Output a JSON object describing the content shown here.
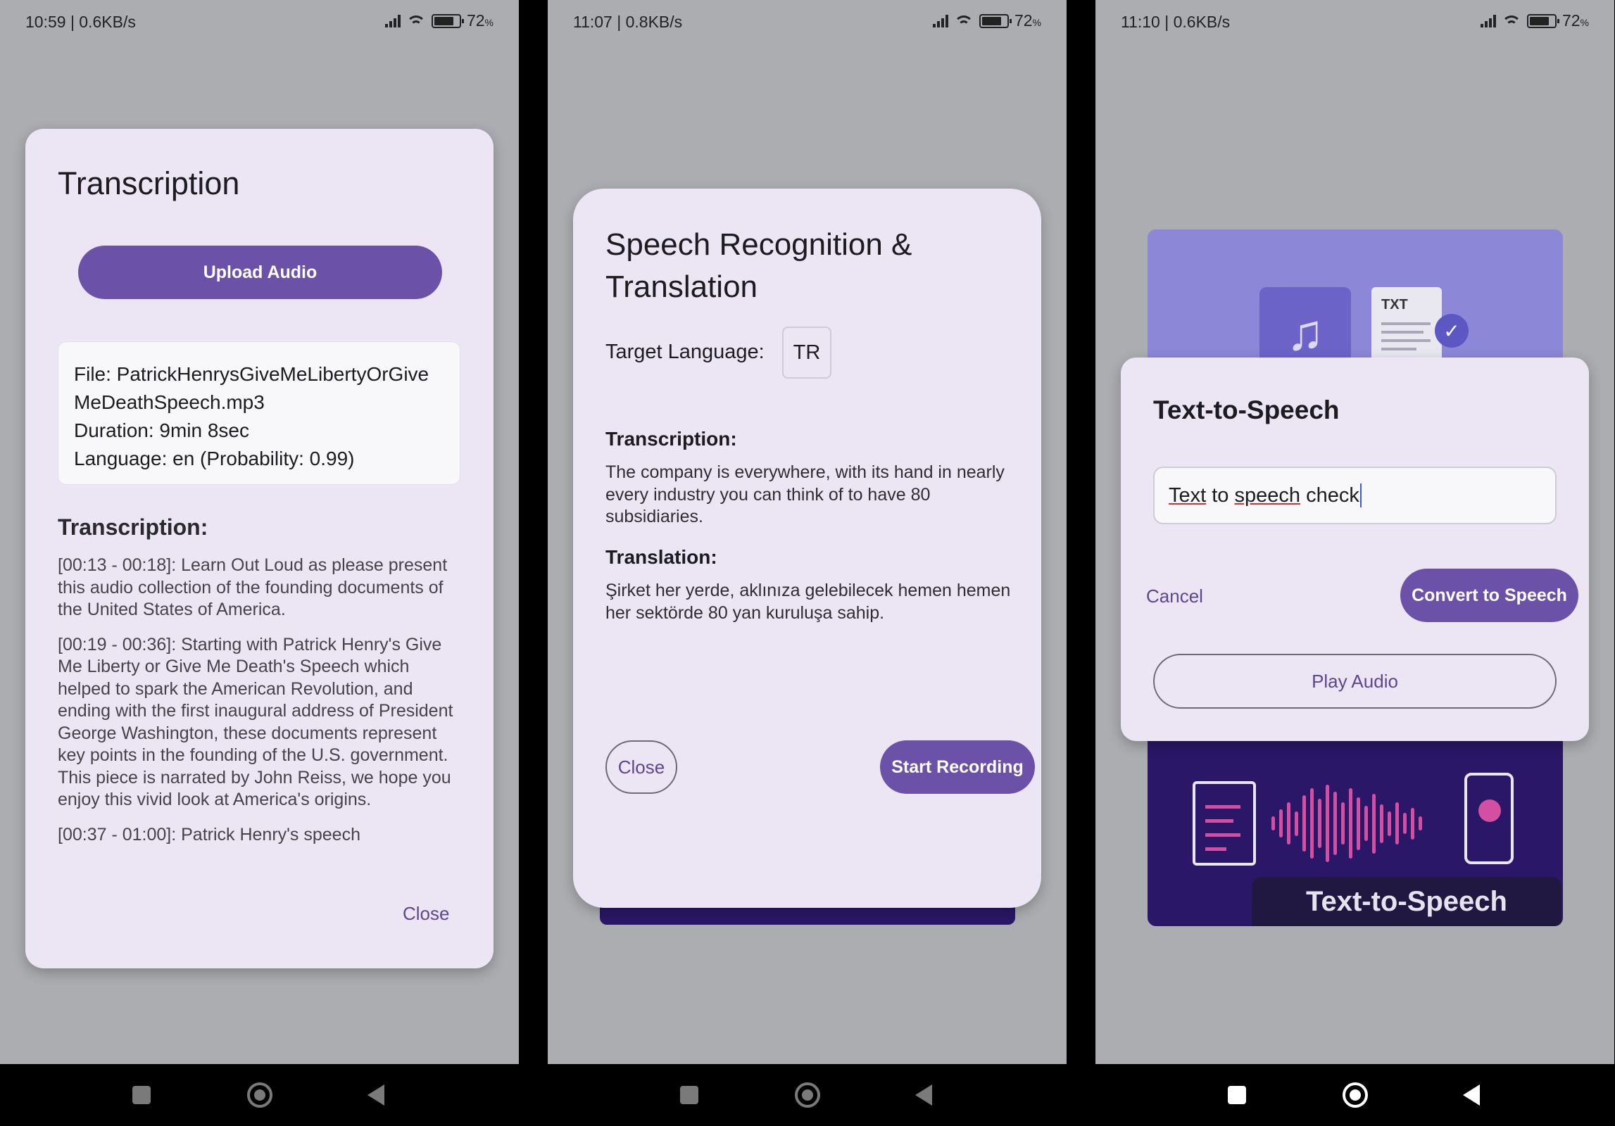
{
  "screen1": {
    "status": {
      "time": "10:59 | 0.6KB/s",
      "battery": "72"
    },
    "dialog": {
      "title": "Transcription",
      "upload_label": "Upload Audio",
      "file": "File: PatrickHenrysGiveMeLibertyOrGiveMeDeathSpeech.mp3",
      "duration": "Duration: 9min 8sec",
      "language": "Language: en (Probability: 0.99)",
      "section": "Transcription:",
      "segments": [
        "[00:13 - 00:18]:  Learn Out Loud as please present this audio collection of the founding documents of the United States of America.",
        "[00:19 - 00:36]:  Starting with Patrick Henry's Give Me Liberty or Give Me Death's Speech which helped to spark the American Revolution, and ending with the first inaugural address of President George Washington, these documents represent key points in the founding of the U.S. government. This piece is narrated by John Reiss, we hope you enjoy this vivid look at America's origins.",
        "[00:37 - 01:00]:  Patrick Henry's speech"
      ],
      "close_label": "Close"
    }
  },
  "screen2": {
    "status": {
      "time": "11:07 | 0.8KB/s",
      "battery": "72"
    },
    "dialog": {
      "title": "Speech Recognition & Translation",
      "target_label": "Target Language:",
      "target_value": "TR",
      "transcription_heading": "Transcription:",
      "transcription_text": " The company is everywhere, with its hand in nearly every industry you can think of to have 80 subsidiaries.",
      "translation_heading": "Translation:",
      "translation_text": "Şirket her yerde, aklınıza gelebilecek hemen hemen her sektörde 80 yan kuruluşa sahip.",
      "close_label": "Close",
      "record_label": "Start Recording"
    }
  },
  "screen3": {
    "status": {
      "time": "11:10 | 0.6KB/s",
      "battery": "72"
    },
    "bg": {
      "txt_label": "TXT",
      "banner": "Text-to-Speech"
    },
    "dialog": {
      "title": "Text-to-Speech",
      "input_w1": "Text",
      "input_w2": " to ",
      "input_w3": "speech",
      "input_w4": " check",
      "cancel_label": "Cancel",
      "convert_label": "Convert to Speech",
      "play_label": "Play Audio"
    }
  },
  "colors": {
    "accent": "#6b52a8",
    "dialog_bg": "#ece6f4",
    "scrim": "#abadb0"
  }
}
